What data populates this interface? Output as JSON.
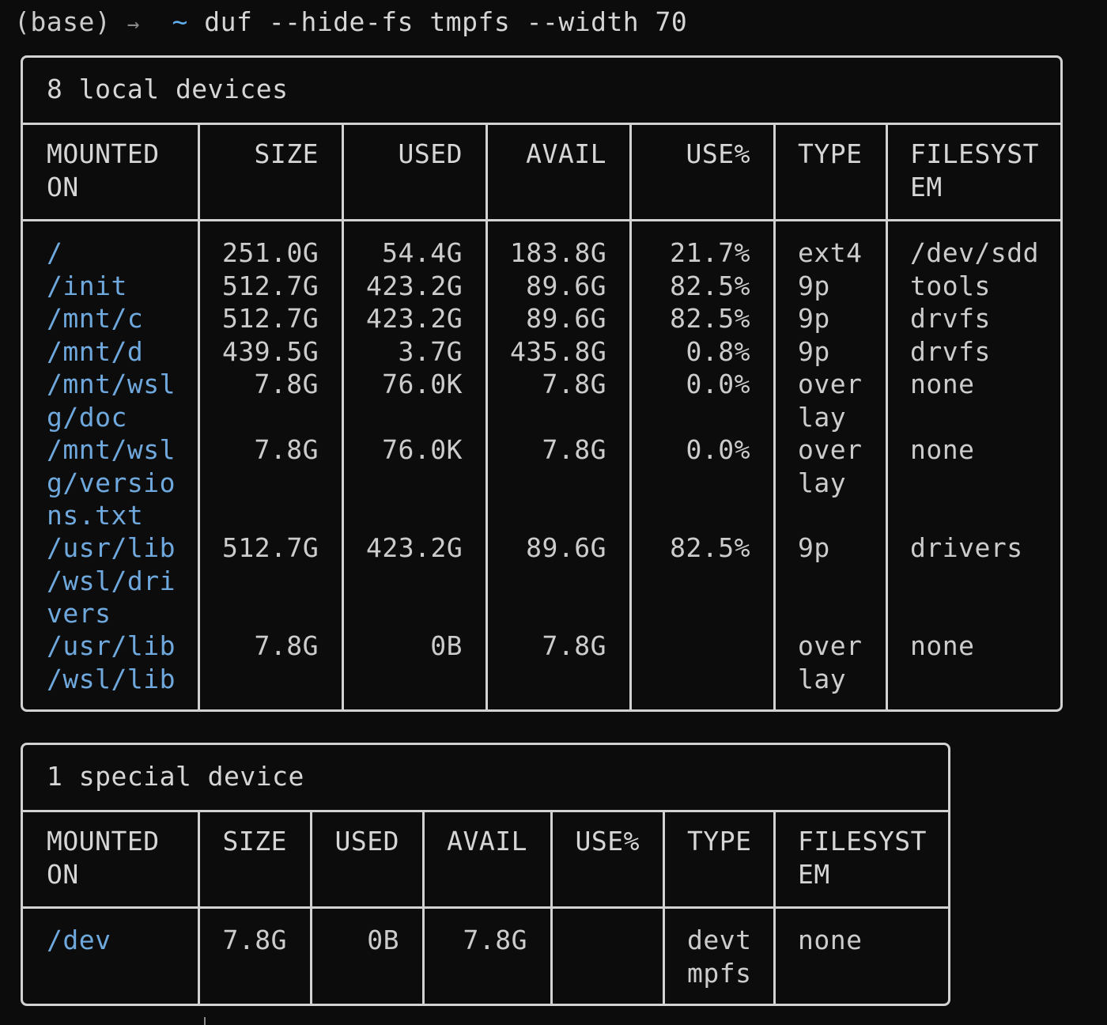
{
  "terminal": {
    "prompt_env": "(base)",
    "prompt_arrow": "→",
    "prompt_dir": "~",
    "command": "duf --hide-fs tmpfs --width 70"
  },
  "local_panel": {
    "title": "8 local devices",
    "headers": [
      "MOUNTED\nON",
      "SIZE",
      "USED",
      "AVAIL",
      "USE%",
      "TYPE",
      "FILESYST\nEM"
    ],
    "rows": [
      {
        "mounted": "/",
        "size": "251.0G",
        "used": "54.4G",
        "avail": "183.8G",
        "use": "21.7%",
        "type": "ext4",
        "fs": "/dev/sdd"
      },
      {
        "mounted": "/init",
        "size": "512.7G",
        "used": "423.2G",
        "avail": "89.6G",
        "use": "82.5%",
        "type": "9p",
        "fs": "tools"
      },
      {
        "mounted": "/mnt/c",
        "size": "512.7G",
        "used": "423.2G",
        "avail": "89.6G",
        "use": "82.5%",
        "type": "9p",
        "fs": "drvfs"
      },
      {
        "mounted": "/mnt/d",
        "size": "439.5G",
        "used": "3.7G",
        "avail": "435.8G",
        "use": "0.8%",
        "type": "9p",
        "fs": "drvfs"
      },
      {
        "mounted": "/mnt/wsl\ng/doc",
        "size": "7.8G",
        "used": "76.0K",
        "avail": "7.8G",
        "use": "0.0%",
        "type": "over\nlay",
        "fs": "none"
      },
      {
        "mounted": "/mnt/wsl\ng/versio\nns.txt",
        "size": "7.8G",
        "used": "76.0K",
        "avail": "7.8G",
        "use": "0.0%",
        "type": "over\nlay",
        "fs": "none"
      },
      {
        "mounted": "/usr/lib\n/wsl/dri\nvers",
        "size": "512.7G",
        "used": "423.2G",
        "avail": "89.6G",
        "use": "82.5%",
        "type": "9p",
        "fs": "drivers"
      },
      {
        "mounted": "/usr/lib\n/wsl/lib",
        "size": "7.8G",
        "used": "0B",
        "avail": "7.8G",
        "use": "",
        "type": "over\nlay",
        "fs": "none"
      }
    ]
  },
  "special_panel": {
    "title": "1 special device",
    "headers": [
      "MOUNTED\nON",
      "SIZE",
      "USED",
      "AVAIL",
      "USE%",
      "TYPE",
      "FILESYST\nEM"
    ],
    "rows": [
      {
        "mounted": "/dev",
        "size": "7.8G",
        "used": "0B",
        "avail": "7.8G",
        "use": "",
        "type": "devt\nmpfs",
        "fs": "none"
      }
    ]
  },
  "colors": {
    "background": "#0c0c0c",
    "text": "#cccccc",
    "mount_path": "#6fa8dc",
    "prompt_tilde": "#61afef",
    "border": "#d2d2d2"
  }
}
